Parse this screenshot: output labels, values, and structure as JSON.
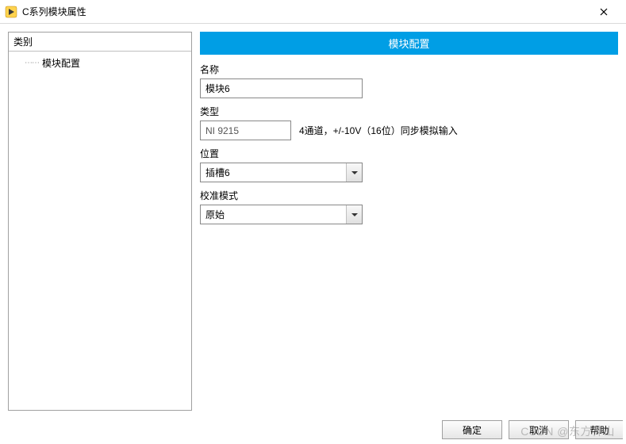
{
  "window": {
    "title": "C系列模块属性"
  },
  "sidebar": {
    "header": "类别",
    "items": [
      {
        "label": "模块配置"
      }
    ]
  },
  "header_bar": "模块配置",
  "form": {
    "name_label": "名称",
    "name_value": "模块6",
    "type_label": "类型",
    "type_value": "NI 9215",
    "type_desc": "4通道，+/-10V（16位）同步模拟输入",
    "position_label": "位置",
    "position_value": "插槽6",
    "calib_label": "校准模式",
    "calib_value": "原始"
  },
  "buttons": {
    "ok": "确定",
    "cancel": "取消",
    "help": "帮助"
  },
  "watermark": "CSDN @东方神山"
}
